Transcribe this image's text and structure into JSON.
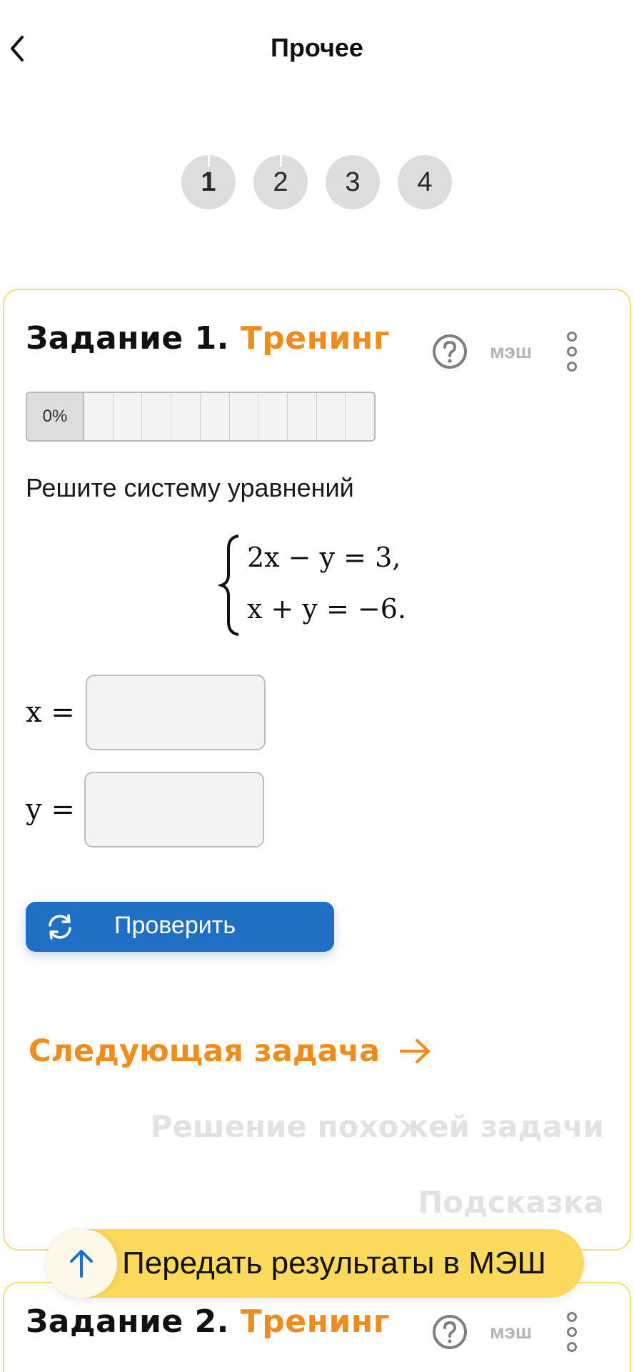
{
  "header": {
    "title": "Прочее"
  },
  "tabs": [
    {
      "label": "1",
      "active": true
    },
    {
      "label": "2",
      "active": false
    },
    {
      "label": "3",
      "active": false
    },
    {
      "label": "4",
      "active": false
    }
  ],
  "task1": {
    "number": "Задание 1.",
    "kind": "Тренинг",
    "mesh": "мэш",
    "progress": "0%",
    "progress_value": 0,
    "prompt": "Решите систему уравнений",
    "equations": [
      "2x − y = 3,",
      "x + y = −6."
    ],
    "x_label": "x =",
    "y_label": "y =",
    "x_value": "",
    "y_value": "",
    "check_label": "Проверить",
    "next_label": "Следующая задача",
    "similar_label": "Решение похожей задачи",
    "hint_label": "Подсказка"
  },
  "task2": {
    "number": "Задание 2.",
    "kind": "Тренинг",
    "mesh": "мэш"
  },
  "send_results": "Передать результаты в МЭШ",
  "colors": {
    "accent": "#ee8c1e",
    "primary": "#1f6fc5",
    "highlight": "#fbd95c",
    "card_border": "#f6dc72"
  }
}
